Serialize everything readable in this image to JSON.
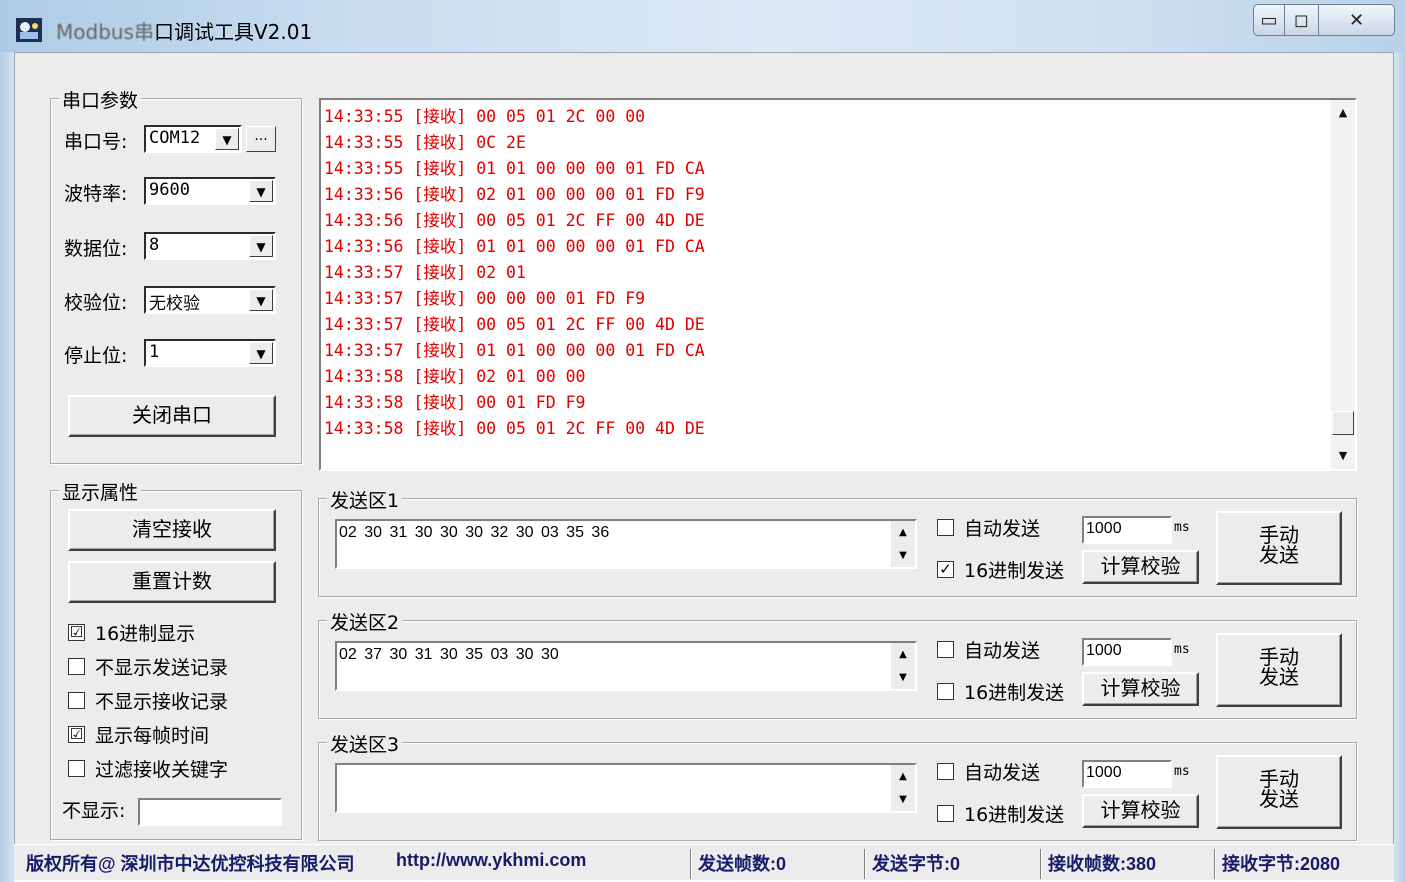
{
  "window": {
    "title_dim": "Modbus串",
    "title": "口调试工具V2.01",
    "min_label": "▭",
    "max_label": "◻",
    "close_label": "✕"
  },
  "serial": {
    "group_title": "串口参数",
    "port_label": "串口号:",
    "port_value": "COM12",
    "browse_label": "...",
    "baud_label": "波特率:",
    "baud_value": "9600",
    "data_label": "数据位:",
    "data_value": "8",
    "parity_label": "校验位:",
    "parity_value": "无校验",
    "stop_label": "停止位:",
    "stop_value": "1",
    "close_button": "关闭串口"
  },
  "display": {
    "group_title": "显示属性",
    "clear_button": "清空接收",
    "reset_button": "重置计数",
    "options": [
      {
        "label": "16进制显示",
        "checked": "☑"
      },
      {
        "label": "不显示发送记录",
        "checked": ""
      },
      {
        "label": "不显示接收记录",
        "checked": ""
      },
      {
        "label": "显示每帧时间",
        "checked": "☑"
      },
      {
        "label": "过滤接收关键字",
        "checked": ""
      }
    ],
    "hide_label": "不显示:",
    "hide_value": ""
  },
  "receive": {
    "lines": [
      "14:33:55 [接收] 00 05 01 2C 00 00",
      "14:33:55 [接收] 0C 2E",
      "14:33:55 [接收] 01 01 00 00 00 01 FD CA",
      "14:33:56 [接收] 02 01 00 00 00 01 FD F9",
      "14:33:56 [接收] 00 05 01 2C FF 00 4D DE",
      "14:33:56 [接收] 01 01 00 00 00 01 FD CA",
      "14:33:57 [接收] 02 01",
      "14:33:57 [接收] 00 00 00 01 FD F9",
      "14:33:57 [接收] 00 05 01 2C FF 00 4D DE",
      "14:33:57 [接收] 01 01 00 00 00 01 FD CA",
      "14:33:58 [接收] 02 01 00 00",
      "14:33:58 [接收] 00 01 FD F9",
      "14:33:58 [接收] 00 05 01 2C FF 00 4D DE"
    ],
    "text_color": "#e00000"
  },
  "send_areas": [
    {
      "title": "发送区1",
      "content": "02 30 31 30 30 30 32 30 03 35 36",
      "auto_send": "自动发送",
      "auto_checked": "",
      "hex_send": "16进制发送",
      "hex_checked": "✓",
      "interval": "1000",
      "unit": "ms",
      "calc_button": "计算校验",
      "send_button_l1": "手动",
      "send_button_l2": "发送"
    },
    {
      "title": "发送区2",
      "content": "02 37 30 31 30 35 03 30 30",
      "auto_send": "自动发送",
      "auto_checked": "",
      "hex_send": "16进制发送",
      "hex_checked": "",
      "interval": "1000",
      "unit": "ms",
      "calc_button": "计算校验",
      "send_button_l1": "手动",
      "send_button_l2": "发送"
    },
    {
      "title": "发送区3",
      "content": "",
      "auto_send": "自动发送",
      "auto_checked": "",
      "hex_send": "16进制发送",
      "hex_checked": "",
      "interval": "1000",
      "unit": "ms",
      "calc_button": "计算校验",
      "send_button_l1": "手动",
      "send_button_l2": "发送"
    }
  ],
  "status": {
    "copyright": "版权所有@ 深圳市中达优控科技有限公司",
    "url": "http://www.ykhmi.com",
    "sent_frames": "发送帧数:0",
    "sent_bytes": "发送字节:0",
    "recv_frames": "接收帧数:380",
    "recv_bytes": "接收字节:2080"
  },
  "icons": {
    "up_arrow": "▲",
    "down_arrow": "▼",
    "combo_arrow": "▼"
  }
}
